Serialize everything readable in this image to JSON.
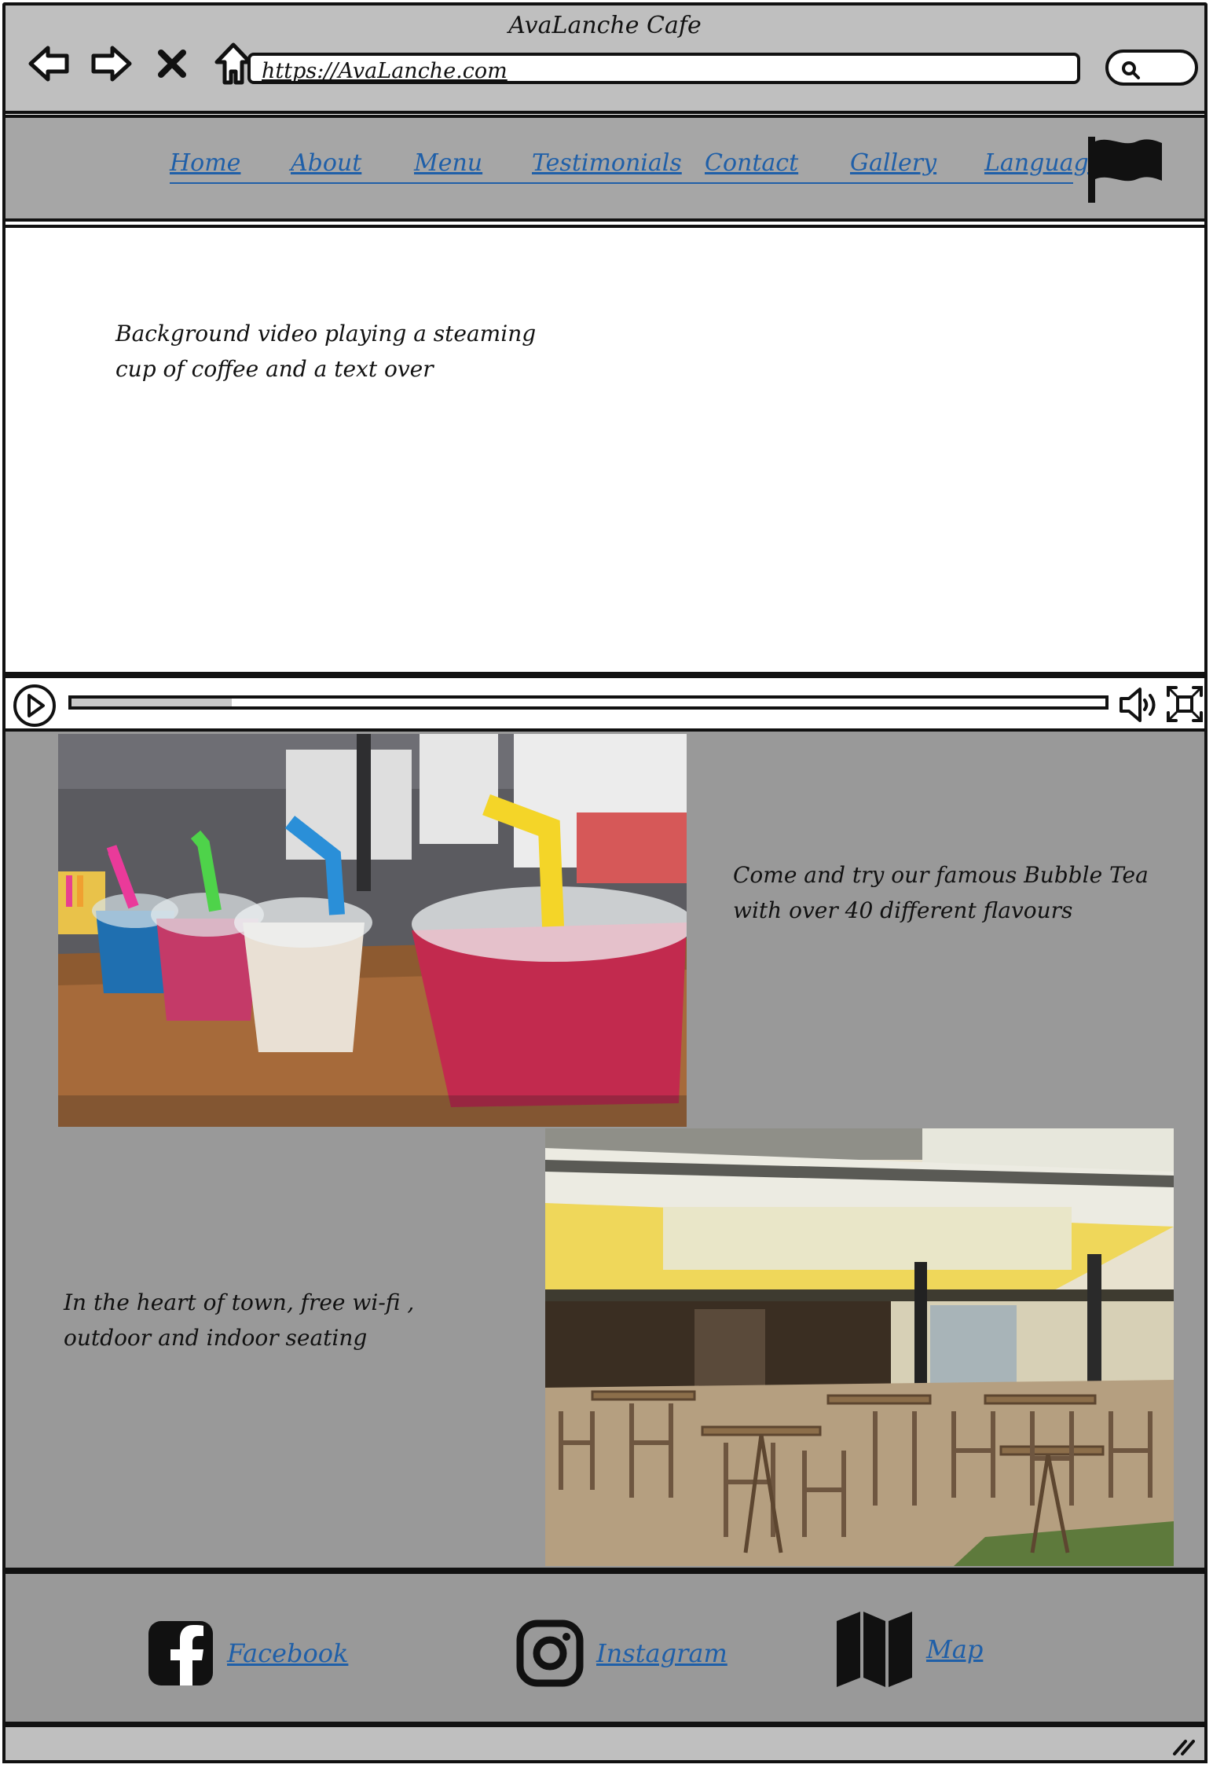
{
  "window": {
    "title": "AvaLanche Cafe"
  },
  "browser": {
    "url": "https://AvaLanche.com",
    "icons": [
      "back-arrow-icon",
      "forward-arrow-icon",
      "close-icon",
      "home-icon",
      "search-icon"
    ]
  },
  "nav": {
    "items": [
      {
        "label": "Home"
      },
      {
        "label": "About"
      },
      {
        "label": "Menu"
      },
      {
        "label": "Testimonials"
      },
      {
        "label": "Contact"
      },
      {
        "label": "Gallery"
      },
      {
        "label": "Language"
      }
    ],
    "language_icon": "flag-icon"
  },
  "hero": {
    "text": "Background video playing a steaming cup of coffee and a text over",
    "video": {
      "progress": 0.155
    }
  },
  "sections": {
    "bubble_tea_text": "Come and try our famous Bubble Tea with over 40 different flavours",
    "location_text": "In the heart of town, free wi-fi , outdoor and indoor seating"
  },
  "footer": {
    "facebook_label": "Facebook",
    "instagram_label": "Instagram",
    "map_label": "Map"
  },
  "colors": {
    "link": "#1f5fa8",
    "chrome": "#bfbfbf",
    "navbar": "#a6a6a6",
    "content_bg": "#999999"
  }
}
